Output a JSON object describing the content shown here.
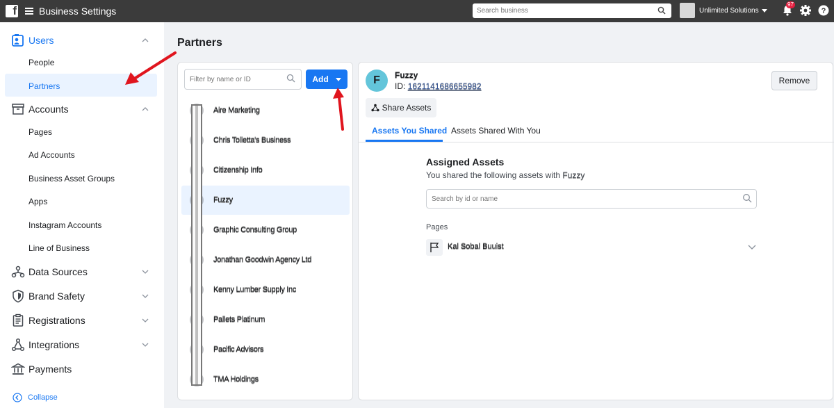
{
  "topbar": {
    "title": "Business Settings",
    "search_placeholder": "Search business",
    "business_name": "Unlimited Solutions",
    "notification_count": "97"
  },
  "sidebar": {
    "sections": [
      {
        "label": "Users",
        "icon": "users-icon",
        "expanded": true,
        "active": true
      },
      {
        "label": "Accounts",
        "icon": "accounts-icon",
        "expanded": true
      },
      {
        "label": "Data Sources",
        "icon": "data-sources-icon",
        "expanded": false
      },
      {
        "label": "Brand Safety",
        "icon": "shield-icon",
        "expanded": false
      },
      {
        "label": "Registrations",
        "icon": "registrations-icon",
        "expanded": false
      },
      {
        "label": "Integrations",
        "icon": "integrations-icon",
        "expanded": false
      },
      {
        "label": "Payments",
        "icon": "payments-icon",
        "expanded": false
      }
    ],
    "users_items": [
      "People",
      "Partners"
    ],
    "accounts_items": [
      "Pages",
      "Ad Accounts",
      "Business Asset Groups",
      "Apps",
      "Instagram Accounts",
      "Line of Business"
    ],
    "collapse_label": "Collapse"
  },
  "main": {
    "page_title": "Partners",
    "filter_placeholder": "Filter by name or ID",
    "add_label": "Add",
    "partners": [
      {
        "name": "Aire Marketing"
      },
      {
        "name": "Chris Tolletta's Business"
      },
      {
        "name": "Citizenship Info"
      },
      {
        "name": "Fuzzy"
      },
      {
        "name": "Graphic Consulting Group"
      },
      {
        "name": "Jonathan Goodwin Agency Ltd"
      },
      {
        "name": "Kenny Lumber Supply Inc"
      },
      {
        "name": "Pallets Platinum"
      },
      {
        "name": "Pacific Advisors"
      },
      {
        "name": "TMA Holdings"
      }
    ],
    "selected_index": 3
  },
  "detail": {
    "avatar_letter": "F",
    "partner_name": "Fuzzy",
    "id_label": "ID:",
    "id_value": "1621141686655982",
    "remove_label": "Remove",
    "share_label": "Share Assets",
    "tabs": [
      "Assets You Shared",
      "Assets Shared With You"
    ],
    "assigned_title": "Assigned Assets",
    "assigned_sub": "You shared the following assets with",
    "assigned_sub_name": "Fuzzy",
    "asset_search_placeholder": "Search by id or name",
    "pages_label": "Pages",
    "page_name": "Kal Sobal Buuist"
  },
  "colors": {
    "topbar": "#3b3b3b",
    "accent": "#1877f2",
    "badge": "#e41e3f",
    "annotation_arrow": "#e0151e"
  }
}
